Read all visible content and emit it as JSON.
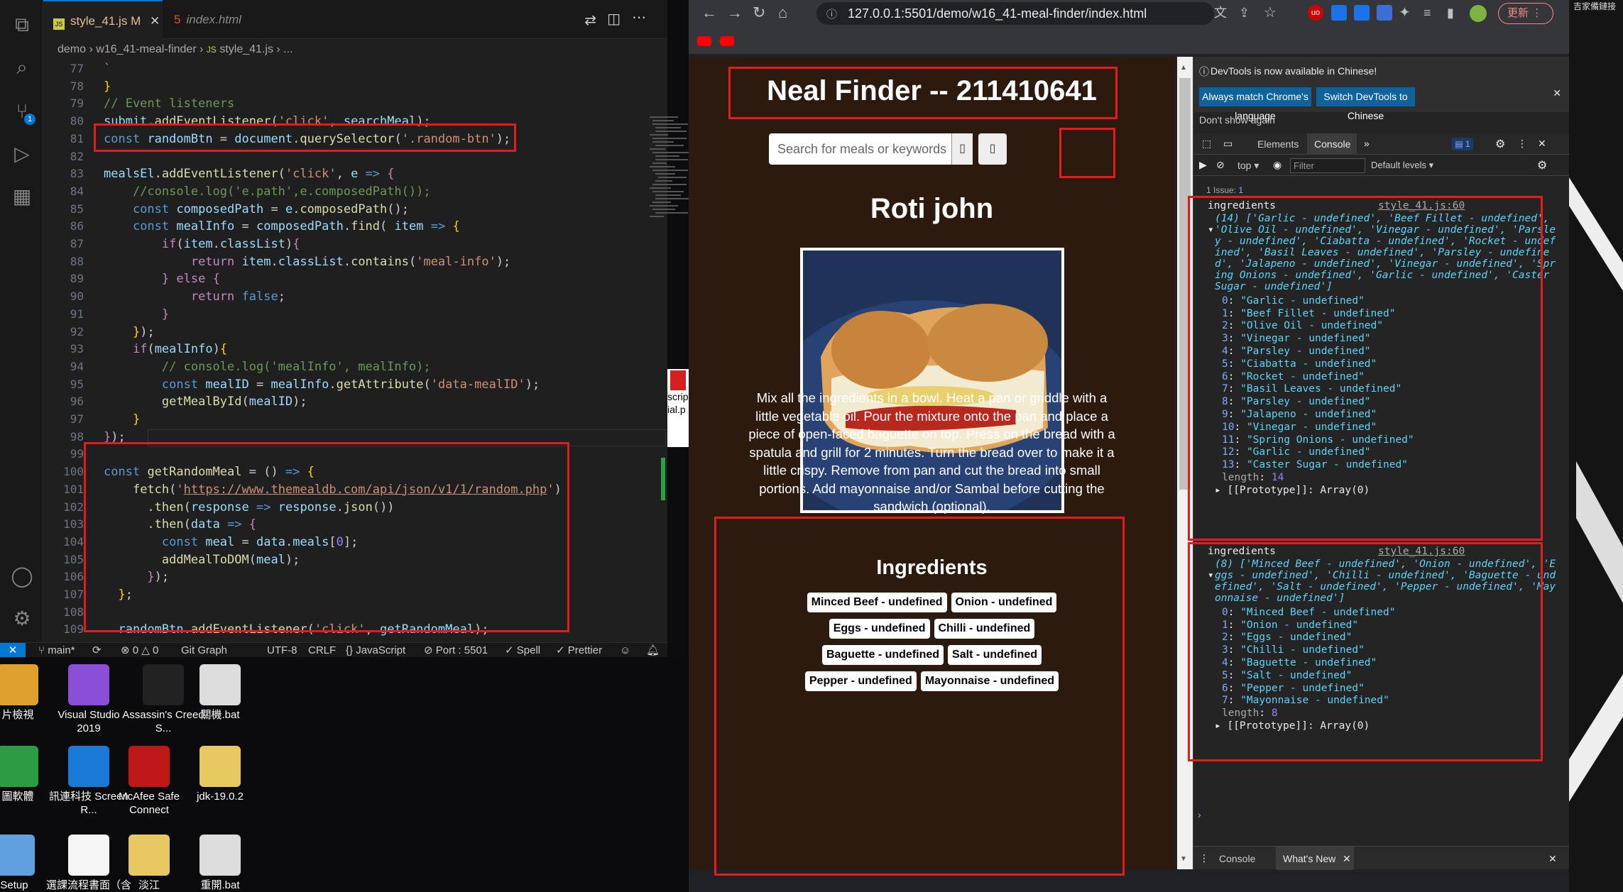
{
  "vscode": {
    "tabs": [
      {
        "name": "style_41.js",
        "status": "M",
        "icon": "JS"
      },
      {
        "name": "index.html",
        "icon": "5"
      }
    ],
    "breadcrumb": [
      "demo",
      "w16_41-meal-finder",
      "style_41.js",
      "..."
    ],
    "code_lines": [
      {
        "n": "77",
        "html": "<span class=\"st\">`</span>"
      },
      {
        "n": "78",
        "html": "<span class=\"pn\">}</span>"
      },
      {
        "n": "79",
        "html": "<span class=\"cm\">// Event listeners</span>"
      },
      {
        "n": "80",
        "html": "<span class=\"vr\">submit</span>.<span class=\"fn\">addEventListener</span>(<span class=\"st\">'click'</span>, <span class=\"vr\">searchMeal</span>);"
      },
      {
        "n": "81",
        "html": "<span class=\"kw\">const</span> <span class=\"vr\">randomBtn</span> = <span class=\"vr\">document</span>.<span class=\"fn\">querySelector</span>(<span class=\"st\">'.random-btn'</span>);"
      },
      {
        "n": "82",
        "html": ""
      },
      {
        "n": "83",
        "html": "<span class=\"vr\">mealsEl</span>.<span class=\"fn\">addEventListener</span>(<span class=\"st\">'click'</span>, <span class=\"vr\">e</span> <span class=\"kw\">=&gt;</span> <span class=\"ky\">{</span>"
      },
      {
        "n": "84",
        "html": "    <span class=\"cm\">//console.log('e.path',e.composedPath());</span>"
      },
      {
        "n": "85",
        "html": "    <span class=\"kw\">const</span> <span class=\"vr\">composedPath</span> = <span class=\"vr\">e</span>.<span class=\"fn\">composedPath</span>();"
      },
      {
        "n": "86",
        "html": "    <span class=\"kw\">const</span> <span class=\"vr\">mealInfo</span> = <span class=\"vr\">composedPath</span>.<span class=\"fn\">find</span>( <span class=\"vr\">item</span> <span class=\"kw\">=&gt;</span> <span class=\"pn\">{</span>"
      },
      {
        "n": "87",
        "html": "        <span class=\"ky\">if</span>(<span class=\"vr\">item</span>.<span class=\"vr\">classList</span>)<span class=\"ky\">{</span>"
      },
      {
        "n": "88",
        "html": "            <span class=\"ky\">return</span> <span class=\"vr\">item</span>.<span class=\"vr\">classList</span>.<span class=\"fn\">contains</span>(<span class=\"st\">'meal-info'</span>);"
      },
      {
        "n": "89",
        "html": "        <span class=\"ky\">}</span> <span class=\"ky\">else</span> <span class=\"ky\">{</span>"
      },
      {
        "n": "90",
        "html": "            <span class=\"ky\">return</span> <span class=\"kw\">false</span>;"
      },
      {
        "n": "91",
        "html": "        <span class=\"ky\">}</span>"
      },
      {
        "n": "92",
        "html": "    <span class=\"pn\">}</span>);"
      },
      {
        "n": "93",
        "html": "    <span class=\"ky\">if</span>(<span class=\"vr\">mealInfo</span>)<span class=\"pn\">{</span>"
      },
      {
        "n": "94",
        "html": "        <span class=\"cm\">// console.log('mealInfo', mealInfo);</span>"
      },
      {
        "n": "95",
        "html": "        <span class=\"kw\">const</span> <span class=\"vr\">mealID</span> = <span class=\"vr\">mealInfo</span>.<span class=\"fn\">getAttribute</span>(<span class=\"st\">'data-mealID'</span>);"
      },
      {
        "n": "96",
        "html": "        <span class=\"fn\">getMealById</span>(<span class=\"vr\">mealID</span>);"
      },
      {
        "n": "97",
        "html": "    <span class=\"pn\">}</span>"
      },
      {
        "n": "98",
        "html": "<span class=\"ky\">}</span>);"
      },
      {
        "n": "99",
        "html": ""
      },
      {
        "n": "100",
        "html": "<span class=\"kw\">const</span> <span class=\"fn\">getRandomMeal</span> = () <span class=\"kw\">=&gt;</span> <span class=\"pn\">{</span>"
      },
      {
        "n": "101",
        "html": "    <span class=\"fn\">fetch</span>(<span class=\"st\">'<u>https://www.themealdb.com/api/json/v1/1/random.php</u>'</span>)"
      },
      {
        "n": "102",
        "html": "      .<span class=\"fn\">then</span>(<span class=\"vr\">response</span> <span class=\"kw\">=&gt;</span> <span class=\"vr\">response</span>.<span class=\"fn\">json</span>())"
      },
      {
        "n": "103",
        "html": "      .<span class=\"fn\">then</span>(<span class=\"vr\">data</span> <span class=\"kw\">=&gt;</span> <span class=\"ky\">{</span>"
      },
      {
        "n": "104",
        "html": "        <span class=\"kw\">const</span> <span class=\"vr\">meal</span> = <span class=\"vr\">data</span>.<span class=\"vr\">meals</span>[<span class=\"cn\">0</span>];"
      },
      {
        "n": "105",
        "html": "        <span class=\"fn\">addMealToDOM</span>(<span class=\"vr\">meal</span>);"
      },
      {
        "n": "106",
        "html": "      <span class=\"ky\">}</span>);"
      },
      {
        "n": "107",
        "html": "  <span class=\"pn\">}</span>;"
      },
      {
        "n": "108",
        "html": ""
      },
      {
        "n": "109",
        "html": "  <span class=\"vr\">randomBtn</span>.<span class=\"fn\">addEventListener</span>(<span class=\"st\">'click'</span>, <span class=\"vr\">getRandomMeal</span>);"
      },
      {
        "n": "110",
        "html": ""
      }
    ],
    "status": {
      "branch": "main*",
      "errors": "0",
      "warnings": "0",
      "git_graph": "Git Graph",
      "encoding": "UTF-8",
      "eol": "CRLF",
      "language": "JavaScript",
      "port": "Port : 5501",
      "spell": "Spell",
      "prettier": "Prettier"
    }
  },
  "desktop": {
    "icons": [
      {
        "label": "片檢視",
        "color": "#e0a030"
      },
      {
        "label": "Visual Studio 2019",
        "color": "#8a4fd6"
      },
      {
        "label": "Assassin's Creed S...",
        "color": "#222"
      },
      {
        "label": "關機.bat",
        "color": "#ddd"
      },
      {
        "label": "圖軟體",
        "color": "#2c9c44"
      },
      {
        "label": "訊連科技 Screen R...",
        "color": "#1a7ad6"
      },
      {
        "label": "McAfee Safe Connect",
        "color": "#c01818"
      },
      {
        "label": "jdk-19.0.2",
        "color": "#e8c860"
      },
      {
        "label": "Setup",
        "color": "#5fa0e0"
      },
      {
        "label": "選課流程書面（含遇...",
        "color": "#f5f5f5"
      },
      {
        "label": "淡江",
        "color": "#e8c860"
      },
      {
        "label": "重開.bat",
        "color": "#ddd"
      }
    ],
    "partial_label": "scrip ial.p"
  },
  "browser": {
    "url": "127.0.0.1:5501/demo/w16_41-meal-finder/index.html",
    "update_label": "更新",
    "page": {
      "title": "Neal Finder -- 211410641",
      "search_placeholder": "Search for meals or keywords",
      "meal_name": "Roti john",
      "instructions": "Mix all the ingredients in a bowl. Heat a pan or griddle with a little vegetable oil. Pour the mixture onto the pan and place a piece of open-faced baguette on top. Press on the bread with a spatula and grill for 2 minutes. Turn the bread over to make it a little crispy. Remove from pan and cut the bread into small portions. Add mayonnaise and/or Sambal before cutting the sandwich (optional).",
      "ingredients_heading": "Ingredients",
      "ingredients": [
        "Minced Beef - undefined",
        "Onion - undefined",
        "Eggs - undefined",
        "Chilli - undefined",
        "Baguette - undefined",
        "Salt - undefined",
        "Pepper - undefined",
        "Mayonnaise - undefined"
      ]
    },
    "devtools": {
      "banner": "DevTools is now available in Chinese!",
      "btn_match": "Always match Chrome's language",
      "btn_switch": "Switch DevTools to Chinese",
      "dont_show": "Don't show again",
      "tabs": [
        "Elements",
        "Console"
      ],
      "issue_badge": "1",
      "context": "top",
      "filter_placeholder": "Filter",
      "levels": "Default levels",
      "issues_line": "1 Issue:",
      "issues_count": "1",
      "log1": {
        "label": "ingredients",
        "source": "style_41.js:60",
        "summary": [
          "(14) ['Garlic - undefined', 'Beef Fillet - undefined',",
          "'Olive Oil - undefined', 'Vinegar - undefined', 'Parsle",
          "y - undefined', 'Ciabatta - undefined', 'Rocket - undef",
          "ined', 'Basil Leaves - undefined', 'Parsley - undefine",
          "d', 'Jalapeno - undefined', 'Vinegar - undefined', 'Spr",
          "ing Onions - undefined', 'Garlic - undefined', 'Caster",
          "Sugar - undefined']"
        ],
        "items": [
          [
            "0",
            "\"Garlic - undefined\""
          ],
          [
            "1",
            "\"Beef Fillet - undefined\""
          ],
          [
            "2",
            "\"Olive Oil - undefined\""
          ],
          [
            "3",
            "\"Vinegar - undefined\""
          ],
          [
            "4",
            "\"Parsley - undefined\""
          ],
          [
            "5",
            "\"Ciabatta - undefined\""
          ],
          [
            "6",
            "\"Rocket - undefined\""
          ],
          [
            "7",
            "\"Basil Leaves - undefined\""
          ],
          [
            "8",
            "\"Parsley - undefined\""
          ],
          [
            "9",
            "\"Jalapeno - undefined\""
          ],
          [
            "10",
            "\"Vinegar - undefined\""
          ],
          [
            "11",
            "\"Spring Onions - undefined\""
          ],
          [
            "12",
            "\"Garlic - undefined\""
          ],
          [
            "13",
            "\"Caster Sugar - undefined\""
          ]
        ],
        "length": "14"
      },
      "log2": {
        "label": "ingredients",
        "source": "style_41.js:60",
        "summary": [
          "(8) ['Minced Beef - undefined', 'Onion - undefined', 'E",
          "ggs - undefined', 'Chilli - undefined', 'Baguette - und",
          "efined', 'Salt - undefined', 'Pepper - undefined', 'May",
          "onnaise - undefined']"
        ],
        "items": [
          [
            "0",
            "\"Minced Beef - undefined\""
          ],
          [
            "1",
            "\"Onion - undefined\""
          ],
          [
            "2",
            "\"Eggs - undefined\""
          ],
          [
            "3",
            "\"Chilli - undefined\""
          ],
          [
            "4",
            "\"Baguette - undefined\""
          ],
          [
            "5",
            "\"Salt - undefined\""
          ],
          [
            "6",
            "\"Pepper - undefined\""
          ],
          [
            "7",
            "\"Mayonnaise - undefined\""
          ]
        ],
        "length": "8"
      },
      "length_key": "length",
      "prototype": "[[Prototype]]: Array(0)",
      "drawer_tabs": [
        "Console",
        "What's New"
      ]
    }
  },
  "desktop_right": {
    "top_text": "吉家備鏈接"
  },
  "colors": {
    "highlight": "#e31c1c",
    "page_bg": "#2d1a0e",
    "accent_blue": "#0e639c"
  }
}
